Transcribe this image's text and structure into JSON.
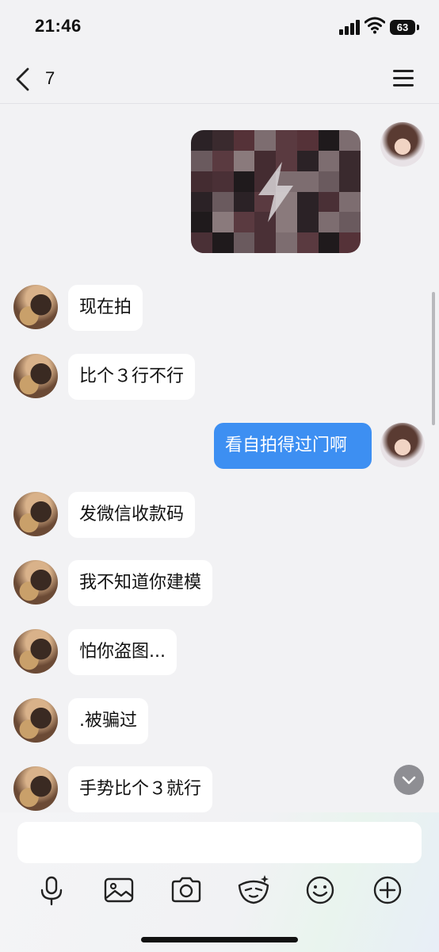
{
  "status_bar": {
    "time": "21:46",
    "battery": "63"
  },
  "header": {
    "title": "7"
  },
  "messages": [
    {
      "side": "out",
      "type": "image"
    },
    {
      "side": "in",
      "text": "现在拍"
    },
    {
      "side": "in",
      "text": "比个３行不行"
    },
    {
      "side": "out",
      "text": "看自拍得过门啊"
    },
    {
      "side": "in",
      "text": "发微信收款码"
    },
    {
      "side": "in",
      "text": "我不知道你建模"
    },
    {
      "side": "in",
      "text": "怕你盗图..."
    },
    {
      "side": "in",
      "text": ".被骗过"
    },
    {
      "side": "in",
      "text": "手势比个３就行"
    }
  ],
  "composer": {
    "placeholder": ""
  },
  "toolbar": [
    "microphone-icon",
    "image-icon",
    "camera-icon",
    "sticker-icon",
    "emoji-icon",
    "plus-icon"
  ],
  "colors": {
    "accent": "#3d8ff2",
    "background": "#f2f2f4"
  }
}
